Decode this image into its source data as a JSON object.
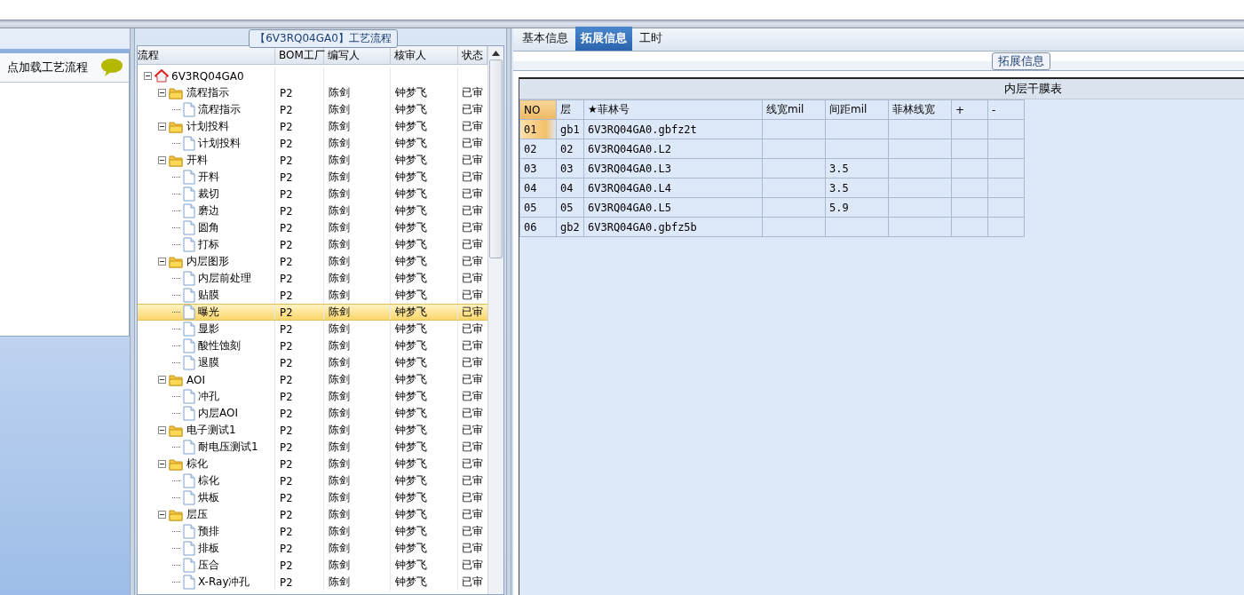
{
  "left_panel": {
    "title": "点加载工艺流程"
  },
  "flow_panel": {
    "title": "【6V3RQ04GA0】工艺流程",
    "columns": [
      "流程",
      "BOM工厂",
      "编写人",
      "核审人",
      "状态"
    ],
    "tree": [
      {
        "kind": "root",
        "label": "6V3RQ04GA0",
        "expanded": true,
        "selected": false,
        "children": [
          {
            "kind": "folder",
            "label": "流程指示",
            "bom": "P2",
            "author": "陈剑",
            "reviewer": "钟梦飞",
            "status": "已审",
            "expanded": true,
            "selected": false,
            "children": [
              {
                "kind": "leaf",
                "label": "流程指示",
                "bom": "P2",
                "author": "陈剑",
                "reviewer": "钟梦飞",
                "status": "已审",
                "selected": false
              }
            ]
          },
          {
            "kind": "folder",
            "label": "计划投料",
            "bom": "P2",
            "author": "陈剑",
            "reviewer": "钟梦飞",
            "status": "已审",
            "expanded": true,
            "selected": false,
            "children": [
              {
                "kind": "leaf",
                "label": "计划投料",
                "bom": "P2",
                "author": "陈剑",
                "reviewer": "钟梦飞",
                "status": "已审",
                "selected": false
              }
            ]
          },
          {
            "kind": "folder",
            "label": "开料",
            "bom": "P2",
            "author": "陈剑",
            "reviewer": "钟梦飞",
            "status": "已审",
            "expanded": true,
            "selected": false,
            "children": [
              {
                "kind": "leaf",
                "label": "开料",
                "bom": "P2",
                "author": "陈剑",
                "reviewer": "钟梦飞",
                "status": "已审",
                "selected": false
              },
              {
                "kind": "leaf",
                "label": "裁切",
                "bom": "P2",
                "author": "陈剑",
                "reviewer": "钟梦飞",
                "status": "已审",
                "selected": false
              },
              {
                "kind": "leaf",
                "label": "磨边",
                "bom": "P2",
                "author": "陈剑",
                "reviewer": "钟梦飞",
                "status": "已审",
                "selected": false
              },
              {
                "kind": "leaf",
                "label": "圆角",
                "bom": "P2",
                "author": "陈剑",
                "reviewer": "钟梦飞",
                "status": "已审",
                "selected": false
              },
              {
                "kind": "leaf",
                "label": "打标",
                "bom": "P2",
                "author": "陈剑",
                "reviewer": "钟梦飞",
                "status": "已审",
                "selected": false
              }
            ]
          },
          {
            "kind": "folder",
            "label": "内层图形",
            "bom": "P2",
            "author": "陈剑",
            "reviewer": "钟梦飞",
            "status": "已审",
            "expanded": true,
            "selected": false,
            "children": [
              {
                "kind": "leaf",
                "label": "内层前处理",
                "bom": "P2",
                "author": "陈剑",
                "reviewer": "钟梦飞",
                "status": "已审",
                "selected": false
              },
              {
                "kind": "leaf",
                "label": "贴膜",
                "bom": "P2",
                "author": "陈剑",
                "reviewer": "钟梦飞",
                "status": "已审",
                "selected": false
              },
              {
                "kind": "leaf",
                "label": "曝光",
                "bom": "P2",
                "author": "陈剑",
                "reviewer": "钟梦飞",
                "status": "已审",
                "selected": true
              },
              {
                "kind": "leaf",
                "label": "显影",
                "bom": "P2",
                "author": "陈剑",
                "reviewer": "钟梦飞",
                "status": "已审",
                "selected": false
              },
              {
                "kind": "leaf",
                "label": "酸性蚀刻",
                "bom": "P2",
                "author": "陈剑",
                "reviewer": "钟梦飞",
                "status": "已审",
                "selected": false
              },
              {
                "kind": "leaf",
                "label": "退膜",
                "bom": "P2",
                "author": "陈剑",
                "reviewer": "钟梦飞",
                "status": "已审",
                "selected": false
              }
            ]
          },
          {
            "kind": "folder",
            "label": "AOI",
            "bom": "P2",
            "author": "陈剑",
            "reviewer": "钟梦飞",
            "status": "已审",
            "expanded": true,
            "selected": false,
            "children": [
              {
                "kind": "leaf",
                "label": "冲孔",
                "bom": "P2",
                "author": "陈剑",
                "reviewer": "钟梦飞",
                "status": "已审",
                "selected": false
              },
              {
                "kind": "leaf",
                "label": "内层AOI",
                "bom": "P2",
                "author": "陈剑",
                "reviewer": "钟梦飞",
                "status": "已审",
                "selected": false
              }
            ]
          },
          {
            "kind": "folder",
            "label": "电子测试1",
            "bom": "P2",
            "author": "陈剑",
            "reviewer": "钟梦飞",
            "status": "已审",
            "expanded": true,
            "selected": false,
            "children": [
              {
                "kind": "leaf",
                "label": "耐电压测试1",
                "bom": "P2",
                "author": "陈剑",
                "reviewer": "钟梦飞",
                "status": "已审",
                "selected": false
              }
            ]
          },
          {
            "kind": "folder",
            "label": "棕化",
            "bom": "P2",
            "author": "陈剑",
            "reviewer": "钟梦飞",
            "status": "已审",
            "expanded": true,
            "selected": false,
            "children": [
              {
                "kind": "leaf",
                "label": "棕化",
                "bom": "P2",
                "author": "陈剑",
                "reviewer": "钟梦飞",
                "status": "已审",
                "selected": false
              },
              {
                "kind": "leaf",
                "label": "烘板",
                "bom": "P2",
                "author": "陈剑",
                "reviewer": "钟梦飞",
                "status": "已审",
                "selected": false
              }
            ]
          },
          {
            "kind": "folder",
            "label": "层压",
            "bom": "P2",
            "author": "陈剑",
            "reviewer": "钟梦飞",
            "status": "已审",
            "expanded": true,
            "selected": false,
            "children": [
              {
                "kind": "leaf",
                "label": "预排",
                "bom": "P2",
                "author": "陈剑",
                "reviewer": "钟梦飞",
                "status": "已审",
                "selected": false
              },
              {
                "kind": "leaf",
                "label": "排板",
                "bom": "P2",
                "author": "陈剑",
                "reviewer": "钟梦飞",
                "status": "已审",
                "selected": false
              },
              {
                "kind": "leaf",
                "label": "压合",
                "bom": "P2",
                "author": "陈剑",
                "reviewer": "钟梦飞",
                "status": "已审",
                "selected": false
              },
              {
                "kind": "leaf",
                "label": "X-Ray冲孔",
                "bom": "P2",
                "author": "陈剑",
                "reviewer": "钟梦飞",
                "status": "已审",
                "selected": false
              }
            ]
          }
        ]
      }
    ]
  },
  "detail": {
    "tabs": [
      {
        "label": "基本信息",
        "selected": false
      },
      {
        "label": "拓展信息",
        "selected": true
      },
      {
        "label": "工时",
        "selected": false
      }
    ],
    "group_title": "拓展信息",
    "table": {
      "caption": "内层干膜表",
      "columns": [
        "NO",
        "层",
        "★菲林号",
        "线宽mil",
        "间距mil",
        "菲林线宽",
        "+",
        "-"
      ],
      "rows": [
        {
          "current": true,
          "cells": [
            "01",
            "gb1",
            "6V3RQ04GA0.gbfz2t",
            "",
            "",
            "",
            "",
            ""
          ]
        },
        {
          "current": false,
          "cells": [
            "02",
            "02",
            "6V3RQ04GA0.L2",
            "",
            "",
            "",
            "",
            ""
          ]
        },
        {
          "current": false,
          "cells": [
            "03",
            "03",
            "6V3RQ04GA0.L3",
            "",
            "3.5",
            "",
            "",
            ""
          ]
        },
        {
          "current": false,
          "cells": [
            "04",
            "04",
            "6V3RQ04GA0.L4",
            "",
            "3.5",
            "",
            "",
            ""
          ]
        },
        {
          "current": false,
          "cells": [
            "05",
            "05",
            "6V3RQ04GA0.L5",
            "",
            "5.9",
            "",
            "",
            ""
          ]
        },
        {
          "current": false,
          "cells": [
            "06",
            "gb2",
            "6V3RQ04GA0.gbfz5b",
            "",
            "",
            "",
            "",
            ""
          ]
        }
      ]
    }
  }
}
